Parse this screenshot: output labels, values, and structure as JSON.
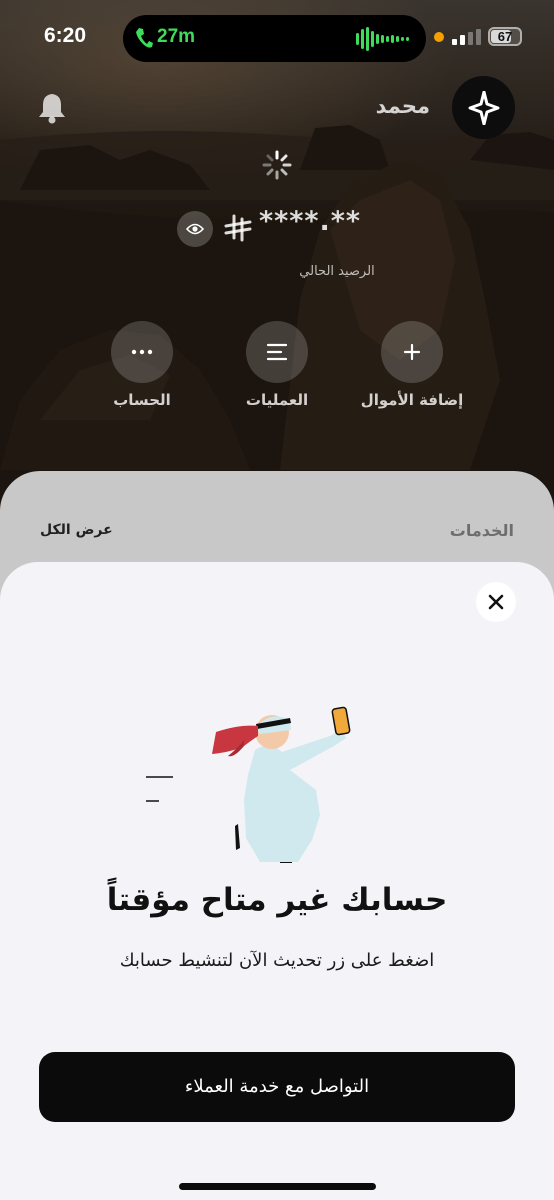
{
  "status_bar": {
    "time": "6:20",
    "call_duration": "27m",
    "battery": "67"
  },
  "header": {
    "user_name": "محمد"
  },
  "balance": {
    "masked_value": "****.**",
    "label": "الرصيد الحالي"
  },
  "actions": [
    {
      "label": "الحساب",
      "icon": "more-dots-icon"
    },
    {
      "label": "العمليات",
      "icon": "list-lines-icon"
    },
    {
      "label": "إضافة الأموال",
      "icon": "plus-icon"
    }
  ],
  "services": {
    "title": "الخدمات",
    "view_all": "عرض الكل"
  },
  "modal": {
    "title": "حسابك غير متاح مؤقتاً",
    "subtitle": "اضغط على زر تحديث الآن لتنشيط حسابك",
    "cta_label": "التواصل مع خدمة العملاء"
  },
  "colors": {
    "call_green": "#3ddc5a",
    "modal_bg": "#f4f3f8",
    "cta_bg": "#0b0b0b",
    "accent_red": "#c8373f",
    "robe": "#cfe9ee"
  }
}
